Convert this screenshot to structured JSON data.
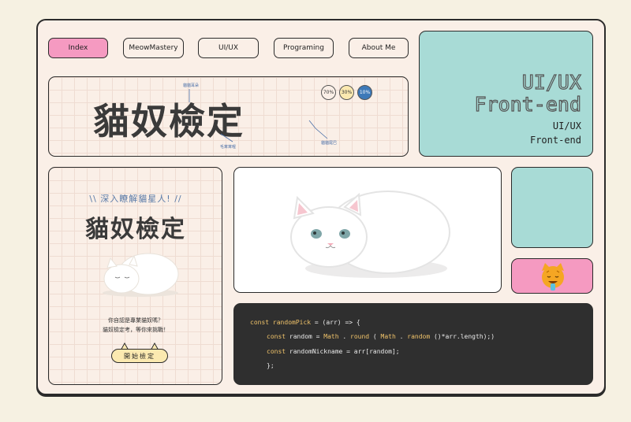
{
  "nav": {
    "items": [
      {
        "label": "Index"
      },
      {
        "label": "MeowMastery"
      },
      {
        "label": "UI/UX"
      },
      {
        "label": "Programing"
      },
      {
        "label": "About Me"
      }
    ]
  },
  "banner": {
    "title": "貓奴檢定",
    "annotations": [
      "貓貓耳朵",
      "毛茸茸喔",
      "貓貓尾巴"
    ],
    "percentages": [
      "70%",
      "30%",
      "10%"
    ]
  },
  "hero": {
    "outline_line1": "UI/UX",
    "outline_line2": "Front-end",
    "small_line1": "UI/UX",
    "small_line2": "Front-end"
  },
  "card": {
    "subtitle": "\\\\ 深入瞭解貓星人! //",
    "title": "貓奴檢定",
    "text_line1": "你自認是專業貓奴嗎？",
    "text_line2": "貓奴檢定考，等你來挑戰！",
    "button": "開始檢定"
  },
  "code": {
    "line1": {
      "kw": "const",
      "name": "randomPick",
      "rest": " = (arr) => {"
    },
    "line2": {
      "kw": "const",
      "name": "random",
      "eq": " = ",
      "m1": "Math",
      "d1": " . ",
      "f1": "round",
      "p1": " ( ",
      "m2": "Math",
      "d2": " . ",
      "f2": "random",
      "rest": " ()*arr.length);)"
    },
    "line3": {
      "kw": "const",
      "name": "randomNickname",
      "rest": " = arr[random];"
    },
    "line4": "};"
  },
  "colors": {
    "pink": "#f59ac1",
    "teal": "#a8dbd6",
    "dark": "#2f2f2f",
    "cream": "#faefe7"
  }
}
